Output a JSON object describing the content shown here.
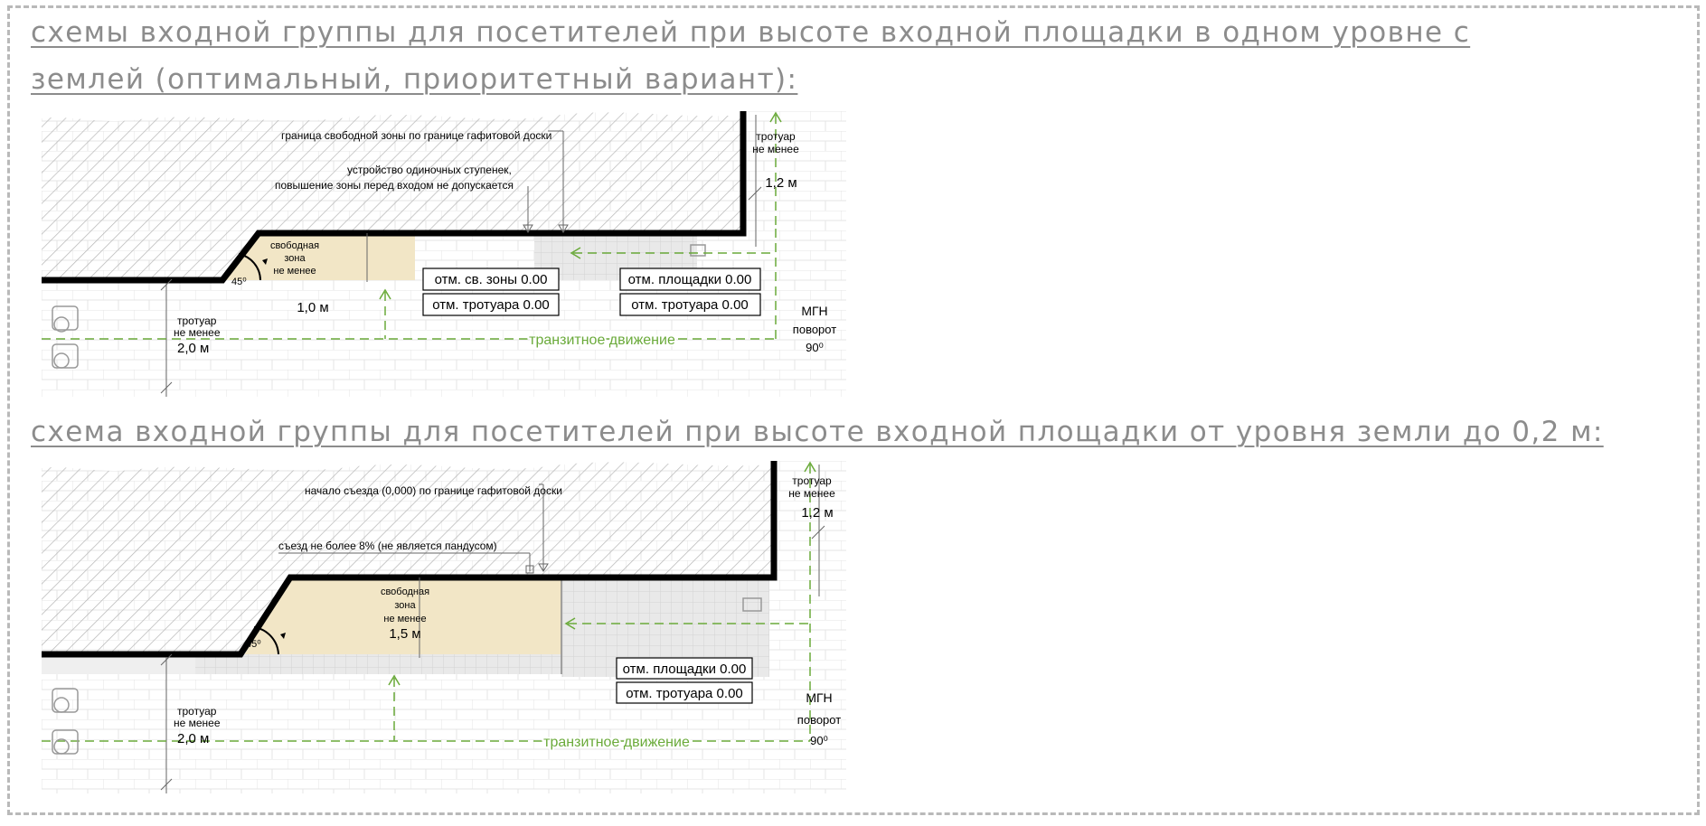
{
  "page": {
    "heading_1_line1": "схемы входной группы для посетителей при высоте входной площадки в одном уровне с",
    "heading_1_line2": "землей (оптимальный, приоритетный вариант):",
    "heading_2": "схема входной группы для посетителей при высоте входной площадки от уровня земли до 0,2 м:"
  },
  "diagram_1": {
    "boundary_note": "граница свободной зоны по границе гафитовой доски",
    "steps_note_line1": "устройство одиночных ступенек,",
    "steps_note_line2": "повышение зоны перед входом не допускается",
    "free_zone_line1": "свободная",
    "free_zone_line2": "зона",
    "free_zone_line3": "не менее",
    "free_zone_size": "1,0 м",
    "angle": "45⁰",
    "label_free_zone_mark": "отм. св. зоны 0.00",
    "label_sidewalk_mark_left": "отм. тротуара 0.00",
    "label_platform_mark": "отм. площадки 0.00",
    "label_sidewalk_mark_right": "отм. тротуара 0.00",
    "sidewalk_left_line1": "тротуар",
    "sidewalk_left_line2": "не менее",
    "sidewalk_left_size": "2,0 м",
    "sidewalk_right_line1": "тротуар",
    "sidewalk_right_line2": "не менее",
    "sidewalk_right_size": "1,2 м",
    "transit": "транзитное движение",
    "mgn_line1": "МГН",
    "mgn_line2": "поворот",
    "mgn_line3": "90⁰"
  },
  "diagram_2": {
    "ramp_start_note": "начало съезда (0,000) по границе гафитовой доски",
    "slope_note": "съезд не более 8% (не является пандусом)",
    "free_zone_line1": "свободная",
    "free_zone_line2": "зона",
    "free_zone_line3": "не менее",
    "free_zone_size": "1,5 м",
    "angle": "45⁰",
    "label_platform_mark": "отм. площадки 0.00",
    "label_sidewalk_mark": "отм. тротуара 0.00",
    "sidewalk_left_line1": "тротуар",
    "sidewalk_left_line2": "не менее",
    "sidewalk_left_size": "2,0 м",
    "sidewalk_right_line1": "тротуар",
    "sidewalk_right_line2": "не менее",
    "sidewalk_right_size": "1,2 м",
    "transit": "транзитное движение",
    "mgn_line1": "МГН",
    "mgn_line2": "поворот",
    "mgn_line3": "90⁰"
  },
  "colors": {
    "heading": "#8c8c8c",
    "frame_border": "#b9b9b9",
    "free_zone_fill": "#f2e6c6",
    "wall": "#000000",
    "hatch": "#b5b5b5",
    "transit_line": "#6aaa3a",
    "platform_fill": "#e6e6e6"
  }
}
